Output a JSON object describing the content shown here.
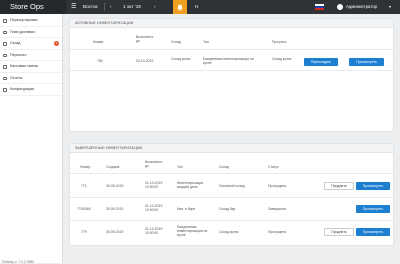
{
  "topbar": {
    "brand": "Store Ops",
    "collapse_icon": "hamburger-icon",
    "store": "Восток",
    "prev_icon": "chevron-left-icon",
    "date": "1 окт '19",
    "next_icon": "chevron-right-icon",
    "bell_icon": "bell-icon",
    "h_label": "Н",
    "flag_colors": [
      "#ffffff",
      "#1c3fa3",
      "#d52b1e"
    ],
    "user_icon": "user-icon",
    "user_name": "Администратор",
    "user_chevron": "chevron-down-icon"
  },
  "sidebar": {
    "items": [
      {
        "label": "Пересортировки",
        "icon": "tag-icon"
      },
      {
        "label": "План доставки",
        "icon": "calendar-icon"
      },
      {
        "label": "Склад",
        "icon": "box-icon",
        "badge": "1"
      },
      {
        "label": "Персонал",
        "icon": "people-icon"
      },
      {
        "label": "Кассовые смены",
        "icon": "cash-icon"
      },
      {
        "label": "Отчеты",
        "icon": "report-icon"
      },
      {
        "label": "Конфигурация",
        "icon": "gear-icon"
      }
    ],
    "version": "DotWay v. 7.0.2.3982"
  },
  "active": {
    "title": "АКТИВНЫЕ ИНВЕНТАРИЗАЦИИ",
    "headers": [
      "Номер",
      "Выполнить до",
      "Склад",
      "Тип",
      "Прогресс"
    ],
    "rows": [
      {
        "number": "780",
        "due": "02-10-2019",
        "warehouse": "Склад кухни",
        "type": "Ежедневная инвентаризация на кухне",
        "progress": "Склад кухни",
        "btn1": "Пересоздать",
        "btn2": "Просмотреть"
      }
    ]
  },
  "completed": {
    "title": "ЗАВЕРШЕННЫЕ ИНВЕНТАРИЗАЦИИ",
    "headers": [
      "Номер",
      "Создана",
      "Выполнить до",
      "Тип",
      "Склад",
      "Статус"
    ],
    "rows": [
      {
        "number": "771",
        "created": "30-09-2019",
        "due": "01-10-2019 10:00:00",
        "type": "Инвентаризация каждый день",
        "warehouse": "Основной склад",
        "status": "Пропущена",
        "btn1": "Продлить",
        "btn2": "Просмотреть"
      },
      {
        "number": "77A0065",
        "created": "30-09-2019",
        "due": "01-10-2019 10:00:00",
        "type": "Инв. в баре",
        "warehouse": "Склад бар",
        "status": "Завершена",
        "btn2": "Просмотреть"
      },
      {
        "number": "779",
        "created": "30-09-2019",
        "due": "01-10-2019 10:00:00",
        "type": "Ежедневная инвентаризация на кухне",
        "warehouse": "Склад кухни",
        "status": "Пропущена",
        "btn1": "Продлить",
        "btn2": "Просмотреть"
      }
    ]
  }
}
